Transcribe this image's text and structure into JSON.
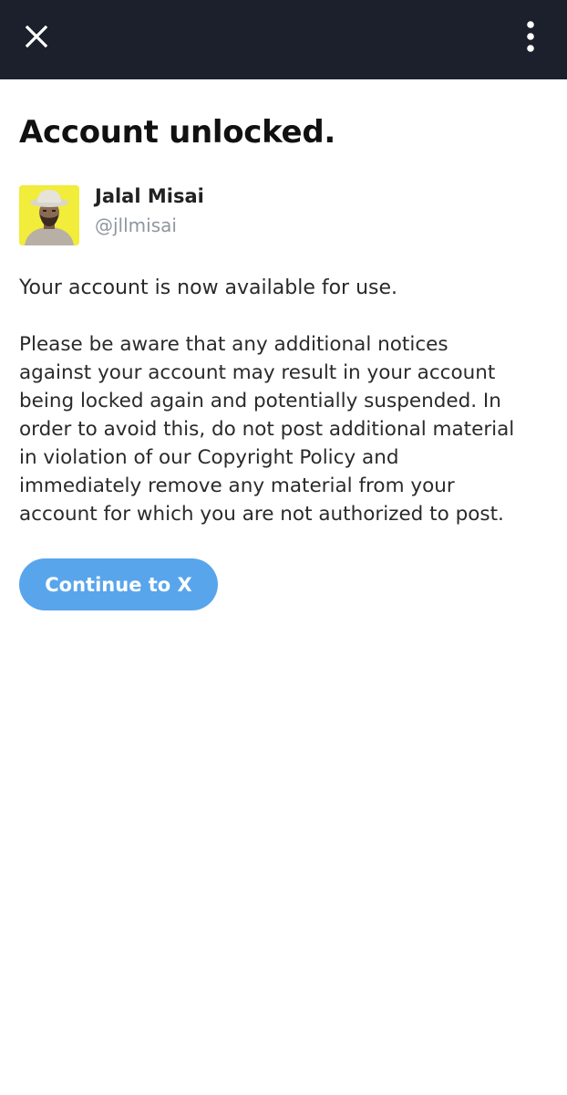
{
  "topbar": {
    "close_icon": "close-icon",
    "menu_icon": "more-vertical-icon",
    "background": "#1b202c"
  },
  "main": {
    "title": "Account unlocked.",
    "user": {
      "name": "Jalal Misai",
      "handle": "@jllmisai"
    },
    "paragraph1": "Your account is now available for use.",
    "paragraph2_lines": [
      "Please be aware that any additional notices",
      "against your account may result in your account",
      "being locked again and potentially suspended. In",
      "order to avoid this, do not post additional material",
      "in violation of our Copyright Policy and",
      "immediately remove any material from your",
      "account for which you are not authorized to post."
    ],
    "continue_label": "Continue to X"
  },
  "colors": {
    "accent": "#58a5ec",
    "handle_text": "#8f969e",
    "avatar_background": "#f2ec3a"
  }
}
